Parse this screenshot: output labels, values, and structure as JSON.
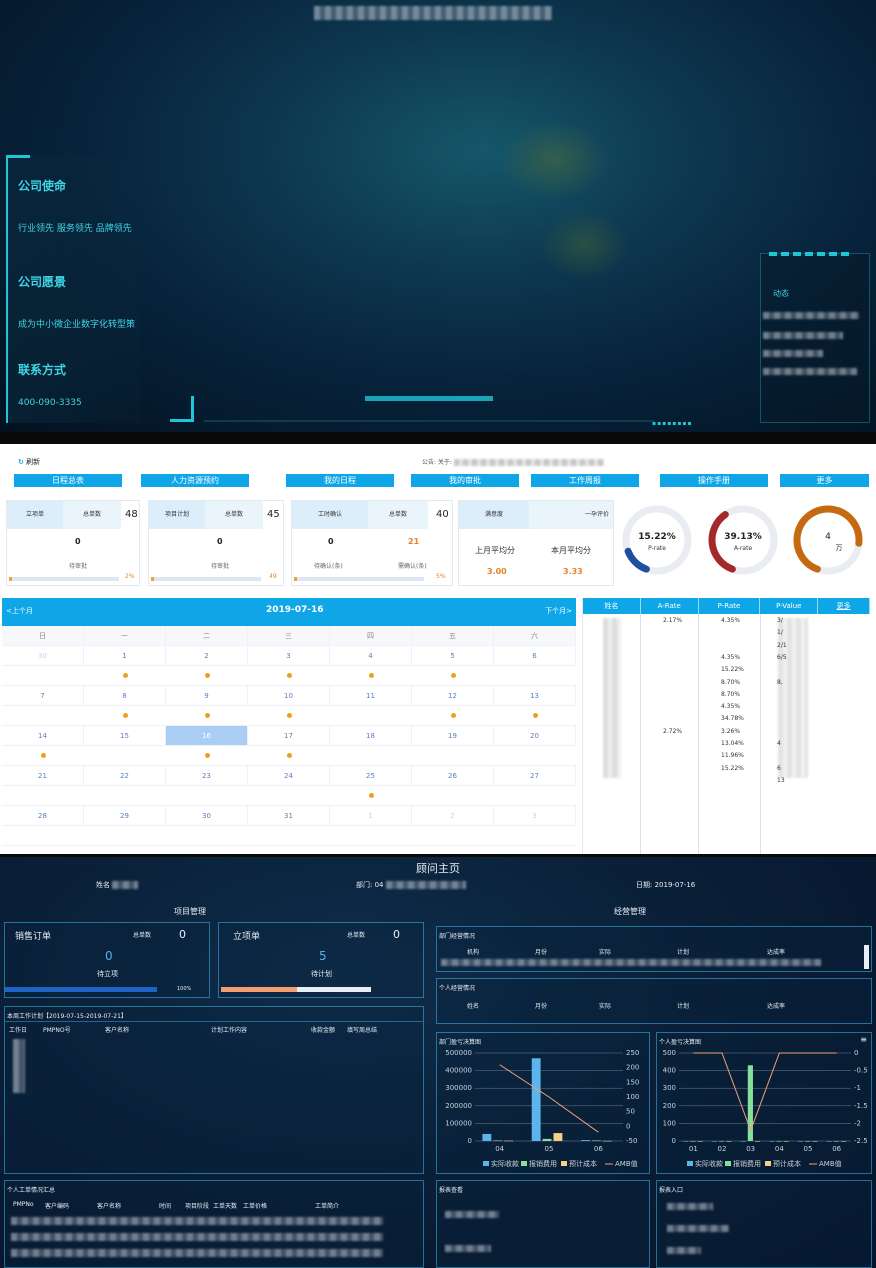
{
  "colors": {
    "accent": "#1fc7d6",
    "blue_btn": "#0fa6e8",
    "orange": "#f0a020",
    "dark_bg": "#07223a"
  },
  "landing": {
    "sections": [
      {
        "heading": "公司使命",
        "text": "行业领先 服务领先 品牌领先"
      },
      {
        "heading": "公司愿景",
        "text": "成为中小微企业数字化转型策"
      },
      {
        "heading": "联系方式",
        "text": "400-090-3335"
      }
    ],
    "news_title": "动态"
  },
  "dashboard": {
    "refresh_label": "刷新",
    "notice_label": "公告: 关于:",
    "nav": [
      "日程总表",
      "人力资源预约",
      "我的日程",
      "我的审批",
      "工作周报",
      "操作手册",
      "更多"
    ],
    "cards": [
      {
        "tab1": "立项单",
        "tab2": "总单数",
        "total": "48",
        "value": "0",
        "label": "待审批",
        "pct": "2%"
      },
      {
        "tab1": "项目计划",
        "tab2": "总单数",
        "total": "45",
        "value": "0",
        "label": "待审批",
        "pct": "49"
      },
      {
        "tab1": "工时确认",
        "tab2": "总单数",
        "total": "40",
        "value": "0",
        "value2": "21",
        "label": "待确认(条)",
        "label2": "需确认(条)",
        "pct": "5%"
      }
    ],
    "satisfaction": {
      "tab1": "满意度",
      "tab2": "一孕评价",
      "last_label": "上月平均分",
      "this_label": "本月平均分",
      "last_value": "3.00",
      "this_value": "3.33"
    },
    "gauges": [
      {
        "value": "15.22%",
        "label": "P-rate",
        "color": "#1e4fa0",
        "fraction": 0.1522
      },
      {
        "value": "39.13%",
        "label": "A-rate",
        "color": "#a42a2a",
        "fraction": 0.3913
      },
      {
        "value": "4",
        "label": "万",
        "color": "#c56a10",
        "fraction": 0.8
      }
    ],
    "calendar": {
      "prev": "<上个月",
      "next": "下个月>",
      "current": "2019-07-16",
      "weekdays": [
        "日",
        "一",
        "二",
        "三",
        "四",
        "五",
        "六"
      ],
      "weeks": [
        [
          "30",
          "1",
          "2",
          "3",
          "4",
          "5",
          "6"
        ],
        [
          "7",
          "8",
          "9",
          "10",
          "11",
          "12",
          "13"
        ],
        [
          "14",
          "15",
          "16",
          "17",
          "18",
          "19",
          "20"
        ],
        [
          "21",
          "22",
          "23",
          "24",
          "25",
          "26",
          "27"
        ],
        [
          "28",
          "29",
          "30",
          "31",
          "1",
          "2",
          "3"
        ]
      ],
      "dots": [
        [
          0,
          1,
          1,
          1,
          1,
          1,
          0
        ],
        [
          0,
          1,
          1,
          1,
          0,
          1,
          1
        ],
        [
          1,
          0,
          1,
          1,
          0,
          0,
          0
        ],
        [
          0,
          0,
          0,
          0,
          1,
          0,
          0
        ],
        [
          0,
          0,
          0,
          0,
          0,
          0,
          0
        ]
      ]
    },
    "rate_table": {
      "headers": [
        "姓名",
        "A-Rate",
        "P-Rate",
        "P-Value",
        "更多"
      ],
      "a_rate": [
        "2.17%",
        "",
        "",
        "",
        "",
        "",
        "",
        "",
        "",
        "2.72%"
      ],
      "p_rate": [
        "4.35%",
        "",
        "",
        "4.35%",
        "15.22%",
        "8.70%",
        "8.70%",
        "4.35%",
        "34.78%",
        "3.26%",
        "13.04%",
        "11.96%",
        "15.22%"
      ],
      "p_value": [
        "3/",
        "1/",
        "2/1",
        "6/5",
        "",
        "8,",
        "",
        "",
        "",
        "",
        "4",
        "",
        "6",
        "13"
      ]
    }
  },
  "consultant": {
    "title": "顾问主页",
    "name_label": "姓名",
    "dept_label": "部门: 04",
    "date_label": "日期: 2019-07-16",
    "project_mgmt": "项目管理",
    "business_mgmt": "经营管理",
    "sales": {
      "title": "销售订单",
      "total_label": "总单数",
      "total": "0",
      "value": "0",
      "label": "待立项",
      "pct": "100%"
    },
    "approval": {
      "title": "立项单",
      "total_label": "总单数",
      "total": "0",
      "value": "5",
      "label": "待计划"
    },
    "weekly_plan_title": "本周工作计划【2019-07-15-2019-07-21】",
    "weekly_plan_headers": [
      "工作日",
      "PMPNO号",
      "客户名称",
      "计划工作内容",
      "收款金额",
      "填写周总结"
    ],
    "dept_status_title": "部门经营情况",
    "dept_status_headers": [
      "机构",
      "月份",
      "实际",
      "计划",
      "达成率"
    ],
    "personal_status_title": "个人经营情况",
    "personal_status_headers": [
      "姓名",
      "月份",
      "实际",
      "计划",
      "达成率"
    ],
    "dept_chart_title": "部门盈亏决算图",
    "personal_chart_title": "个人盈亏决算图",
    "work_summary_title": "个人工单情况汇总",
    "work_summary_headers": [
      "PMPNo",
      "客户编码",
      "客户名称",
      "时间",
      "项目阶段",
      "工单天数",
      "工单价格",
      "工单简介"
    ],
    "report_query_title": "报表查看",
    "report_entry_title": "报表入口"
  },
  "chart_data": [
    {
      "type": "bar",
      "categories": [
        "04",
        "05",
        "06"
      ],
      "series": [
        {
          "name": "实际收款",
          "values": [
            40000,
            470000,
            5000
          ]
        },
        {
          "name": "报销费用",
          "values": [
            3000,
            12000,
            3000
          ]
        },
        {
          "name": "预计成本",
          "values": [
            2000,
            45000,
            1000
          ]
        },
        {
          "name": "AMB值",
          "values": [
            210,
            100,
            -20
          ]
        }
      ],
      "ylim": [
        0,
        500000
      ],
      "ylim_right": [
        -50,
        250
      ]
    },
    {
      "type": "bar",
      "categories": [
        "01",
        "02",
        "03",
        "04",
        "05",
        "06"
      ],
      "series": [
        {
          "name": "实际收款",
          "values": [
            0,
            0,
            0,
            0,
            0,
            0
          ]
        },
        {
          "name": "报销费用",
          "values": [
            0,
            0,
            430,
            0,
            0,
            0
          ]
        },
        {
          "name": "预计成本",
          "values": [
            0,
            0,
            0,
            0,
            0,
            0
          ]
        },
        {
          "name": "AMB值",
          "values": [
            0,
            0,
            -2.2,
            0,
            0,
            0
          ]
        }
      ],
      "ylim": [
        0,
        500
      ],
      "ylim_right": [
        -2.5,
        0
      ]
    }
  ]
}
